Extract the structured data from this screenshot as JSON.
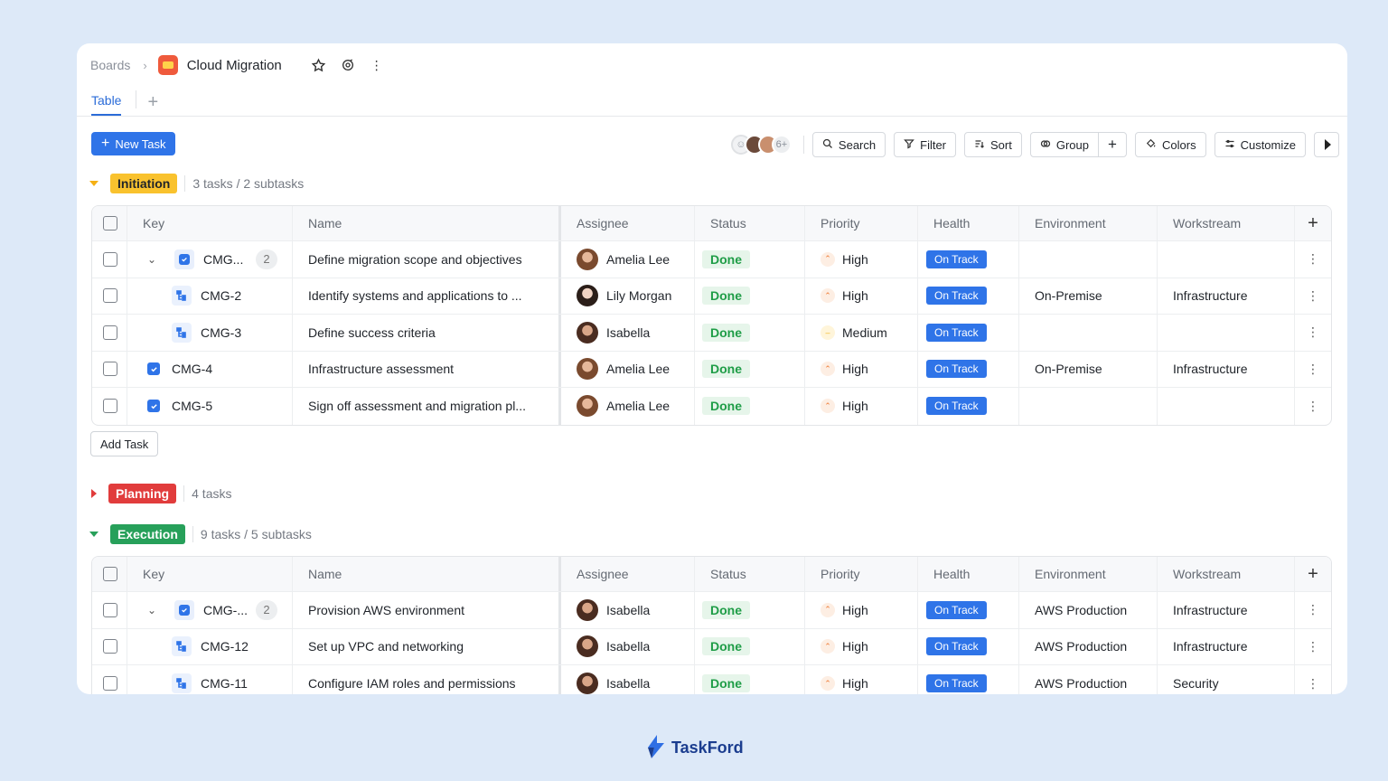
{
  "breadcrumb": {
    "root": "Boards",
    "board_title": "Cloud Migration"
  },
  "tabs": [
    {
      "label": "Table"
    }
  ],
  "toolbar": {
    "new_task": "New Task",
    "avatar_overflow": "6+",
    "search": "Search",
    "filter": "Filter",
    "sort": "Sort",
    "group": "Group",
    "colors": "Colors",
    "customize": "Customize"
  },
  "columns": {
    "key": "Key",
    "name": "Name",
    "assignee": "Assignee",
    "status": "Status",
    "priority": "Priority",
    "health": "Health",
    "environment": "Environment",
    "workstream": "Workstream"
  },
  "groups": [
    {
      "label": "Initiation",
      "count": "3 tasks / 2 subtasks",
      "color": "#f9c22e",
      "text_color": "#1f2329"
    },
    {
      "label": "Planning",
      "count": "4 tasks",
      "color": "#e13c3c",
      "text_color": "#ffffff"
    },
    {
      "label": "Execution",
      "count": "9 tasks / 5 subtasks",
      "color": "#27a05a",
      "text_color": "#ffffff"
    }
  ],
  "initiation_rows": [
    {
      "key": "CMG...",
      "subtasks": "2",
      "name": "Define migration scope and objectives",
      "assignee": "Amelia Lee",
      "status": "Done",
      "priority": "High",
      "health": "On Track",
      "environment": "",
      "workstream": ""
    },
    {
      "key": "CMG-2",
      "name": "Identify systems and applications to ...",
      "assignee": "Lily Morgan",
      "status": "Done",
      "priority": "High",
      "health": "On Track",
      "environment": "On-Premise",
      "workstream": "Infrastructure"
    },
    {
      "key": "CMG-3",
      "name": "Define success criteria",
      "assignee": "Isabella",
      "status": "Done",
      "priority": "Medium",
      "health": "On Track",
      "environment": "",
      "workstream": ""
    },
    {
      "key": "CMG-4",
      "name": "Infrastructure assessment",
      "assignee": "Amelia Lee",
      "status": "Done",
      "priority": "High",
      "health": "On Track",
      "environment": "On-Premise",
      "workstream": "Infrastructure"
    },
    {
      "key": "CMG-5",
      "name": "Sign off assessment and migration pl...",
      "assignee": "Amelia Lee",
      "status": "Done",
      "priority": "High",
      "health": "On Track",
      "environment": "",
      "workstream": ""
    }
  ],
  "add_task": "Add Task",
  "execution_rows": [
    {
      "key": "CMG-...",
      "subtasks": "2",
      "name": "Provision AWS environment",
      "assignee": "Isabella",
      "status": "Done",
      "priority": "High",
      "health": "On Track",
      "environment": "AWS Production",
      "workstream": "Infrastructure"
    },
    {
      "key": "CMG-12",
      "name": "Set up VPC and networking",
      "assignee": "Isabella",
      "status": "Done",
      "priority": "High",
      "health": "On Track",
      "environment": "AWS Production",
      "workstream": "Infrastructure"
    },
    {
      "key": "CMG-11",
      "name": "Configure IAM roles and permissions",
      "assignee": "Isabella",
      "status": "Done",
      "priority": "High",
      "health": "On Track",
      "environment": "AWS Production",
      "workstream": "Security"
    }
  ],
  "brand": "TaskFord",
  "colors": {
    "accent": "#2f74e8",
    "done_bg": "#e6f5ea",
    "done_text": "#1f9d47"
  }
}
